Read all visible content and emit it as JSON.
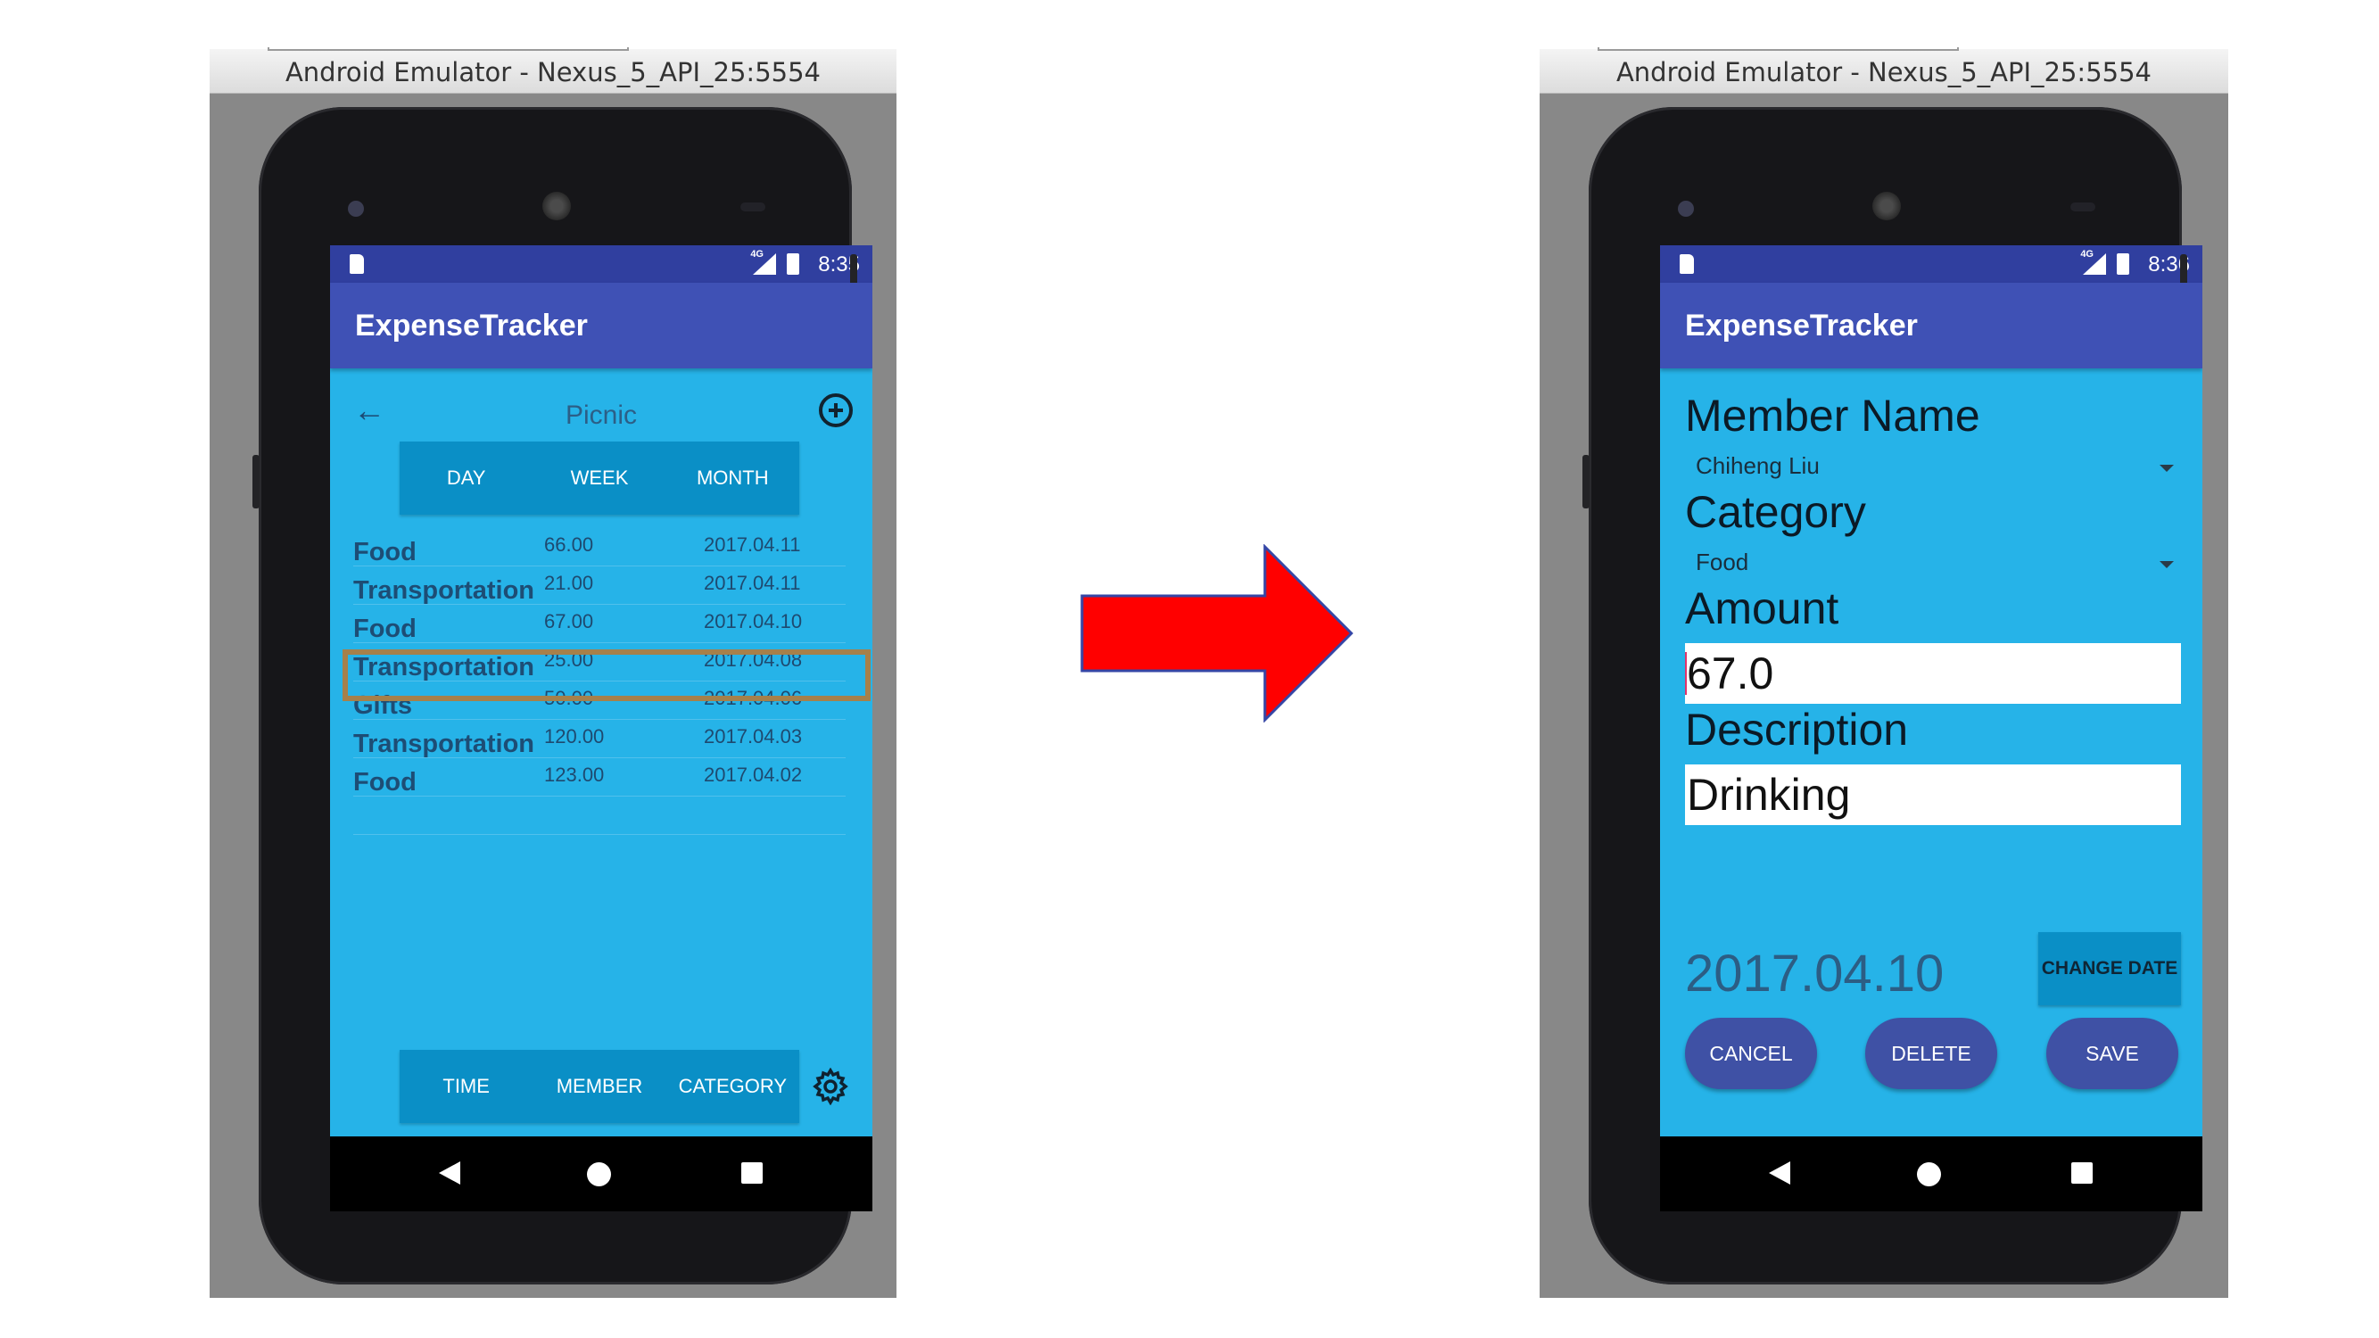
{
  "colors": {
    "screen_bg": "#26b3e8",
    "appbar": "#3f51b5",
    "statusbar": "#303f9f",
    "segment_bg": "#0a8fc6",
    "pill_button": "#3f51a5",
    "highlight_box": "#a6804a",
    "arrow": "#ff0000"
  },
  "left": {
    "window_title": "Android Emulator - Nexus_5_API_25:5554",
    "status_time": "8:35",
    "network": "4G",
    "app_title": "ExpenseTracker",
    "list_title": "Picnic",
    "period_tabs": [
      "DAY",
      "WEEK",
      "MONTH"
    ],
    "rows": [
      {
        "category": "Food",
        "amount": "66.00",
        "date": "2017.04.11"
      },
      {
        "category": "Transportation",
        "amount": "21.00",
        "date": "2017.04.11"
      },
      {
        "category": "Food",
        "amount": "67.00",
        "date": "2017.04.10"
      },
      {
        "category": "Transportation",
        "amount": "25.00",
        "date": "2017.04.08"
      },
      {
        "category": "Gifts",
        "amount": "50.00",
        "date": "2017.04.06"
      },
      {
        "category": "Transportation",
        "amount": "120.00",
        "date": "2017.04.03"
      },
      {
        "category": "Food",
        "amount": "123.00",
        "date": "2017.04.02"
      }
    ],
    "highlighted_row": 2,
    "sort_tabs": [
      "TIME",
      "MEMBER",
      "CATEGORY"
    ]
  },
  "right": {
    "window_title": "Android Emulator - Nexus_5_API_25:5554",
    "status_time": "8:36",
    "network": "4G",
    "app_title": "ExpenseTracker",
    "member_label": "Member Name",
    "member_value": "Chiheng Liu",
    "category_label": "Category",
    "category_value": "Food",
    "amount_label": "Amount",
    "amount_value": "67.0",
    "description_label": "Description",
    "description_value": "Drinking",
    "date_value": "2017.04.10",
    "change_date_label": "CHANGE DATE",
    "cancel_label": "CANCEL",
    "delete_label": "DELETE",
    "save_label": "SAVE"
  }
}
